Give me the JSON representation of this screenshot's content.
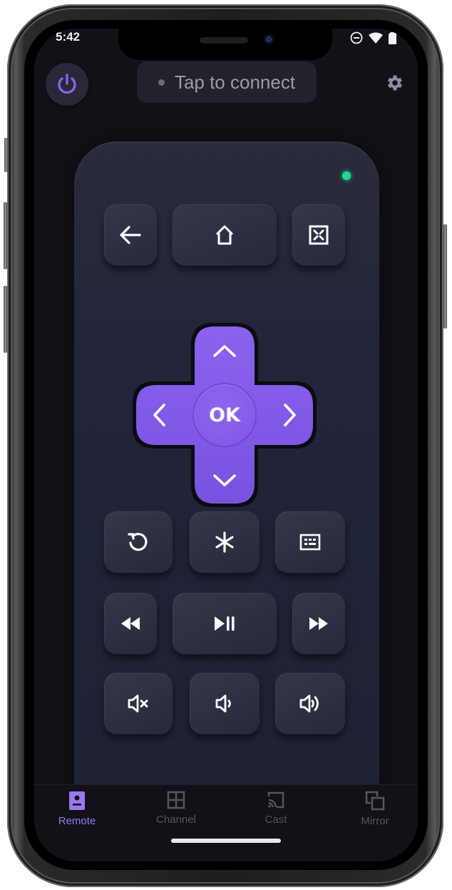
{
  "status_bar": {
    "time": "5:42",
    "icons": [
      "do-not-disturb-icon",
      "wifi-icon",
      "battery-icon"
    ]
  },
  "header": {
    "power_icon": "power-icon",
    "connect_label": "Tap to connect",
    "connection_status": "disconnected",
    "settings_icon": "gear-icon"
  },
  "remote": {
    "led_color": "#1ed98e",
    "top_row": [
      {
        "name": "back",
        "icon": "arrow-left-icon"
      },
      {
        "name": "home",
        "icon": "home-icon"
      },
      {
        "name": "fullscreen",
        "icon": "fullscreen-exit-icon"
      }
    ],
    "dpad": {
      "ok_label": "OK",
      "up": "chevron-up-icon",
      "down": "chevron-down-icon",
      "left": "chevron-left-icon",
      "right": "chevron-right-icon",
      "color": "#7e58e8"
    },
    "row_2": [
      {
        "name": "replay",
        "icon": "replay-icon"
      },
      {
        "name": "options",
        "icon": "asterisk-icon"
      },
      {
        "name": "keyboard",
        "icon": "keyboard-icon"
      }
    ],
    "row_3": [
      {
        "name": "rewind",
        "icon": "rewind-icon"
      },
      {
        "name": "play-pause",
        "icon": "play-pause-icon"
      },
      {
        "name": "fast-forward",
        "icon": "fast-forward-icon"
      }
    ],
    "row_4": [
      {
        "name": "mute",
        "icon": "volume-mute-icon"
      },
      {
        "name": "volume-down",
        "icon": "volume-down-icon"
      },
      {
        "name": "volume-up",
        "icon": "volume-up-icon"
      }
    ]
  },
  "bottom_nav": {
    "accent_color": "#9a78ee",
    "items": [
      {
        "label": "Remote",
        "icon": "remote-icon",
        "active": true
      },
      {
        "label": "Channel",
        "icon": "grid-icon",
        "active": false
      },
      {
        "label": "Cast",
        "icon": "cast-icon",
        "active": false
      },
      {
        "label": "Mirror",
        "icon": "mirror-icon",
        "active": false
      }
    ]
  }
}
